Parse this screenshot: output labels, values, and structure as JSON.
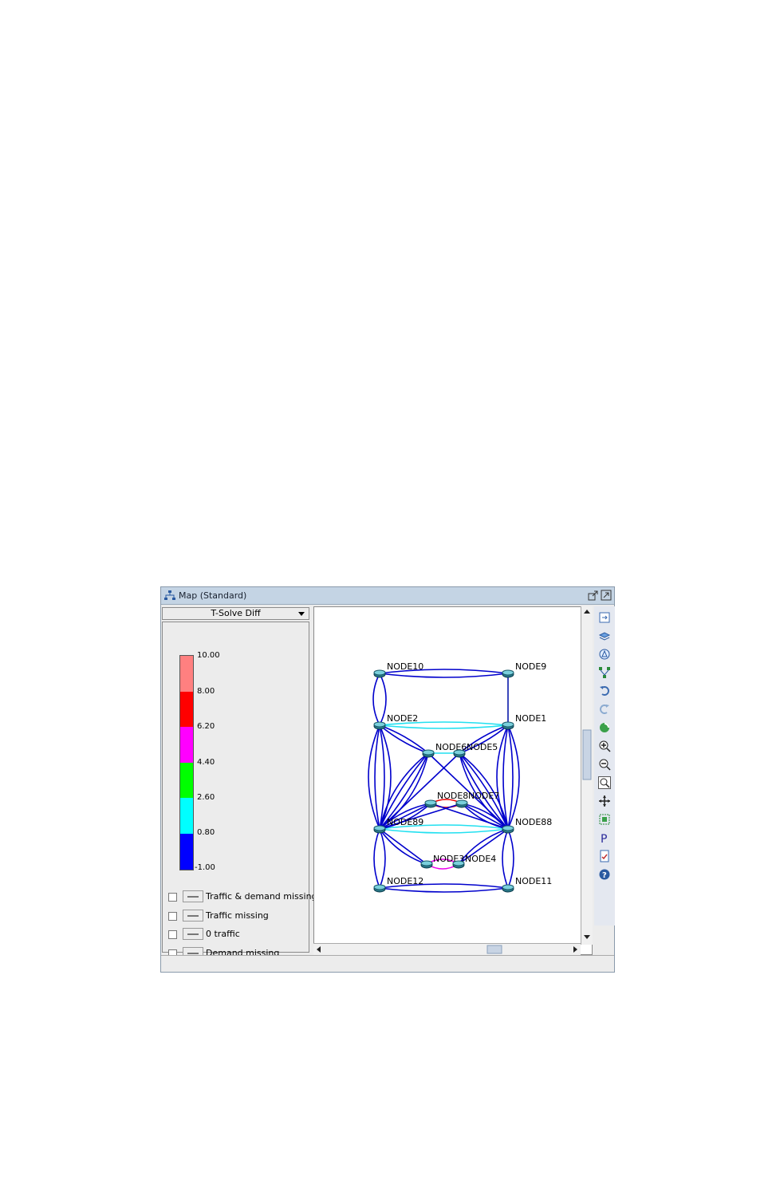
{
  "window": {
    "title": "Map (Standard)"
  },
  "dropdown": {
    "selected": "T-Solve Diff"
  },
  "legend": {
    "ticks": [
      "10.00",
      "8.00",
      "6.20",
      "4.40",
      "2.60",
      "0.80",
      "-1.00"
    ],
    "colors": [
      "#ff8080",
      "#ff0000",
      "#ff00ff",
      "#00ff00",
      "#00ffff",
      "#0000ff"
    ],
    "checkboxes": [
      "Traffic & demand missing",
      "Traffic missing",
      "0 traffic",
      "Demand missing"
    ]
  },
  "nodes": [
    {
      "id": "n10",
      "label": "NODE10"
    },
    {
      "id": "n9",
      "label": "NODE9"
    },
    {
      "id": "n2",
      "label": "NODE2"
    },
    {
      "id": "n1",
      "label": "NODE1"
    },
    {
      "id": "n6",
      "label": "NODE6"
    },
    {
      "id": "n5",
      "label": "NODE5"
    },
    {
      "id": "n8",
      "label": "NODE8"
    },
    {
      "id": "n7",
      "label": "NODE7"
    },
    {
      "id": "n89",
      "label": "NODE89"
    },
    {
      "id": "n88",
      "label": "NODE88"
    },
    {
      "id": "n3",
      "label": "NODE3"
    },
    {
      "id": "n4",
      "label": "NODE4"
    },
    {
      "id": "n12",
      "label": "NODE12"
    },
    {
      "id": "n11",
      "label": "NODE11"
    }
  ],
  "toolbar": [
    "fit-icon",
    "layer-icon",
    "filter-icon",
    "layout-icon",
    "undo-icon",
    "redo-icon",
    "refresh-icon",
    "zoom-in-icon",
    "zoom-out-icon",
    "zoom-fit-icon",
    "pan-icon",
    "select-icon",
    "properties-icon",
    "report-icon",
    "help-icon"
  ]
}
